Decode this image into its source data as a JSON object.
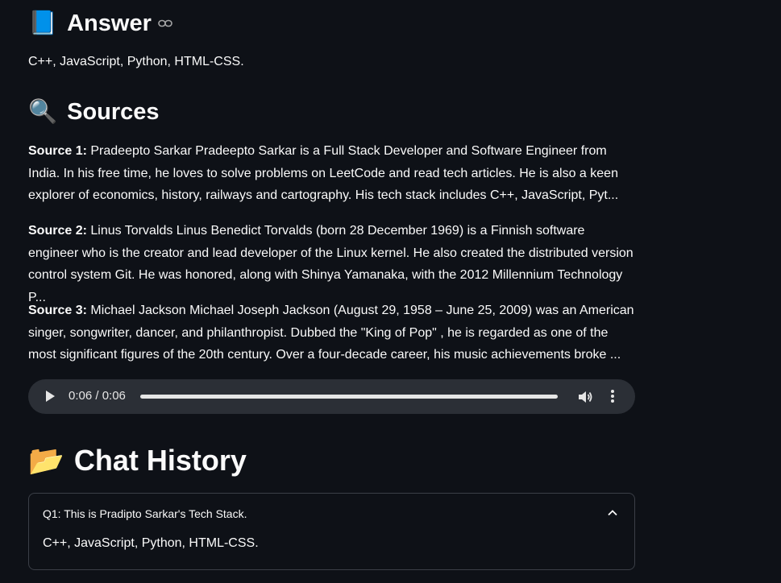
{
  "answer": {
    "emoji": "📘",
    "heading": "Answer",
    "text": "C++, JavaScript, Python, HTML-CSS."
  },
  "sources": {
    "emoji": "🔍",
    "heading": "Sources",
    "items": [
      {
        "label": "Source 1:",
        "text": "Pradeepto Sarkar Pradeepto Sarkar is a Full Stack Developer and Software Engineer from India. In his free time, he loves to solve problems on LeetCode and read tech articles. He is also a keen explorer of economics, history, railways and cartography. His tech stack includes C++, JavaScript, Pyt..."
      },
      {
        "label": "Source 2:",
        "text": "Linus Torvalds Linus Benedict Torvalds (born 28 December 1969) is a Finnish software engineer who is the creator and lead developer of the Linux kernel. He also created the distributed version control system Git. He was honored, along with Shinya Yamanaka, with the 2012 Millennium Technology P..."
      },
      {
        "label": "Source 3:",
        "text": "Michael Jackson Michael Joseph Jackson (August 29, 1958 – June 25, 2009) was an American singer, songwriter, dancer, and philanthropist. Dubbed the \"King of Pop\" , he is regarded as one of the most significant figures of the 20th century. Over a four-decade career, his music achievements broke ..."
      }
    ]
  },
  "audio": {
    "time": "0:06 / 0:06",
    "progress": 1.0
  },
  "chat_history": {
    "emoji": "📂",
    "heading": "Chat History",
    "entries": [
      {
        "question": "Q1: This is Pradipto Sarkar's Tech Stack.",
        "answer": "C++, JavaScript, Python, HTML-CSS."
      }
    ]
  },
  "icons": {
    "link": "link-icon",
    "play": "play-icon",
    "volume": "volume-icon",
    "more": "more-vertical-icon",
    "chevron": "chevron-up-icon"
  }
}
